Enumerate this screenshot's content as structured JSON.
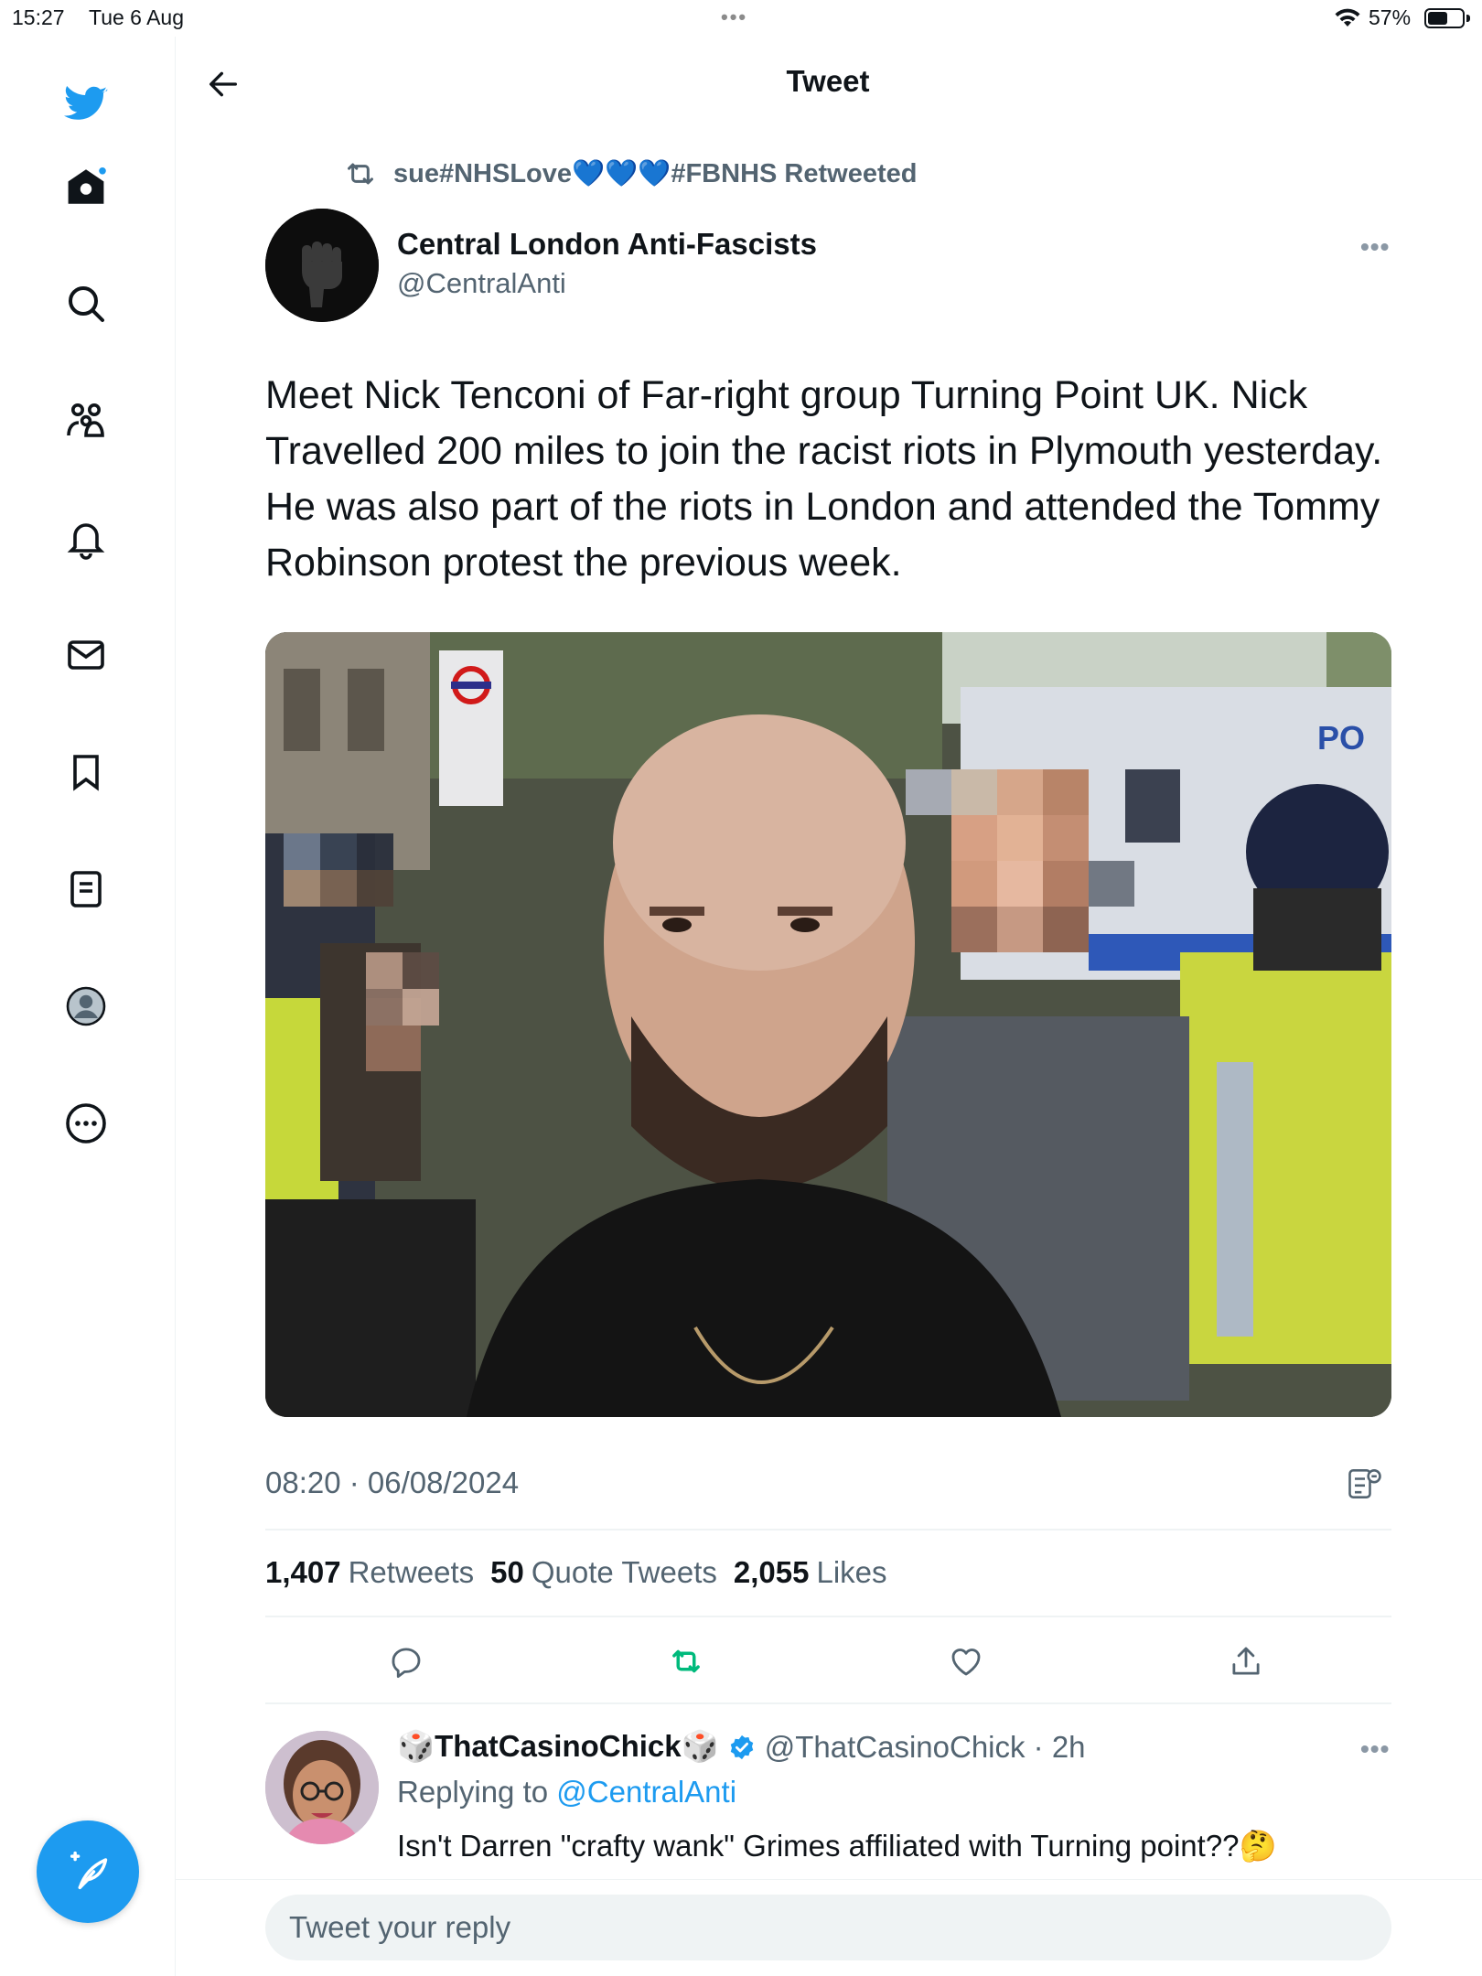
{
  "status_bar": {
    "time": "15:27",
    "date": "Tue 6 Aug",
    "multitask_dots": "•••",
    "battery_percent": "57%",
    "battery_level": 0.57
  },
  "sidebar": {
    "items": [
      {
        "name": "twitter-logo-icon"
      },
      {
        "name": "home-icon",
        "has_notification_dot": true
      },
      {
        "name": "search-icon"
      },
      {
        "name": "communities-icon"
      },
      {
        "name": "notifications-icon"
      },
      {
        "name": "messages-icon"
      },
      {
        "name": "bookmarks-icon"
      },
      {
        "name": "lists-icon"
      },
      {
        "name": "profile-icon"
      },
      {
        "name": "more-icon"
      }
    ],
    "compose_icon": "compose-feather-icon"
  },
  "header": {
    "title": "Tweet",
    "back_icon": "back-arrow-icon"
  },
  "tweet": {
    "retweeted_by": "sue#NHSLove💙💙💙#FBNHS Retweeted",
    "author_name": "Central London Anti-Fascists",
    "author_handle": "@CentralAnti",
    "text": "Meet Nick Tenconi of Far-right group Turning Point UK. Nick Travelled 200 miles to join the racist riots in Plymouth yesterday. He was also part of the riots in London and attended the Tommy Robinson protest the previous week.",
    "timestamp": "08:20 · 06/08/2024",
    "stats": {
      "retweets_count": "1,407",
      "retweets_label": "Retweets",
      "quotes_count": "50",
      "quotes_label": "Quote Tweets",
      "likes_count": "2,055",
      "likes_label": "Likes"
    },
    "media_sign_text": "PO"
  },
  "reply": {
    "name": "🎲ThatCasinoChick🎲",
    "handle": "@ThatCasinoChick · 2h",
    "replying_prefix": "Replying to",
    "replying_to": "@CentralAnti",
    "text": "Isn't  Darren \"crafty wank\" Grimes affiliated with Turning point??🤔"
  },
  "composer": {
    "placeholder": "Tweet your reply"
  },
  "colors": {
    "accent": "#1d9bf0",
    "retweet_green": "#00ba7c",
    "secondary_text": "#536471"
  }
}
